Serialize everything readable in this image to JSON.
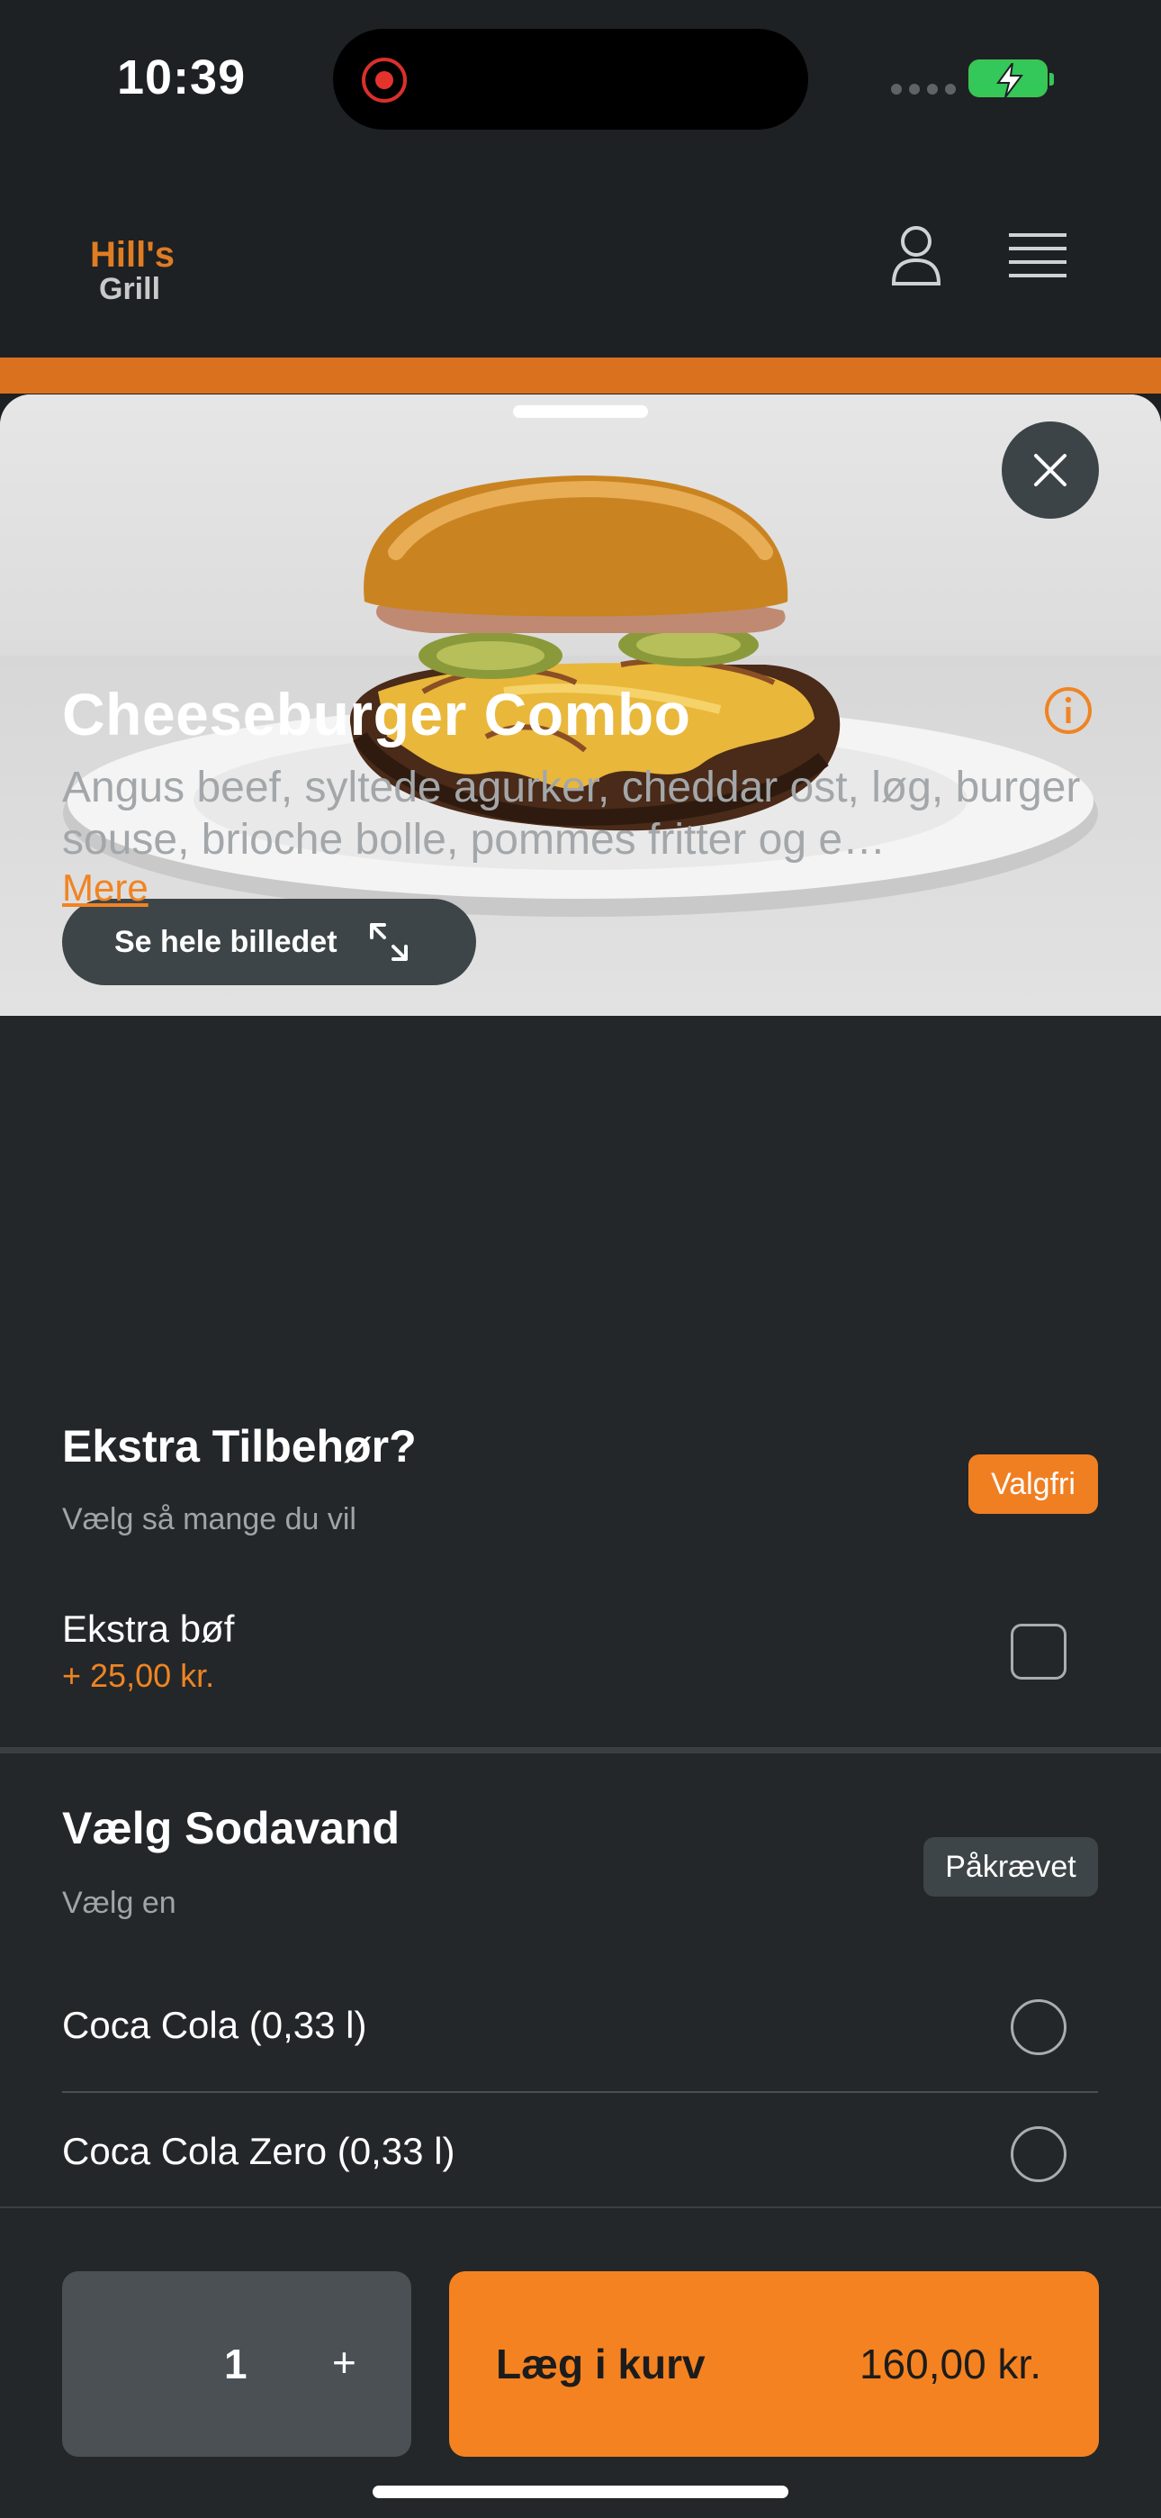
{
  "status_bar": {
    "time": "10:39"
  },
  "header": {
    "logo_line1": "Hill's",
    "logo_line2": "Grill",
    "icons": [
      "profile-icon",
      "hamburger-menu-icon"
    ]
  },
  "product": {
    "see_full_image_label": "Se hele billedet",
    "title": "Cheeseburger Combo",
    "description": "Angus beef,  syltede agurker, cheddar ost, løg, burger souse, brioche bolle, pommes fritter og e…",
    "more_label": "Mere"
  },
  "extras_section": {
    "title": "Ekstra Tilbehør?",
    "subtitle": "Vælg så mange du vil",
    "badge": "Valgfri",
    "options": [
      {
        "name": "Ekstra bøf",
        "price": "+ 25,00 kr.",
        "checked": false
      }
    ]
  },
  "soda_section": {
    "title": "Vælg Sodavand",
    "subtitle": "Vælg en",
    "badge": "Påkrævet",
    "options": [
      {
        "name": "Coca Cola (0,33 l)",
        "selected": false
      },
      {
        "name": "Coca Cola Zero (0,33 l)",
        "selected": false
      }
    ]
  },
  "cart": {
    "quantity": "1",
    "plus": "+",
    "add_label": "Læg i kurv",
    "price": "160,00 kr."
  },
  "colors": {
    "accent": "#f58220",
    "background": "#232729",
    "header": "#1d2124"
  }
}
